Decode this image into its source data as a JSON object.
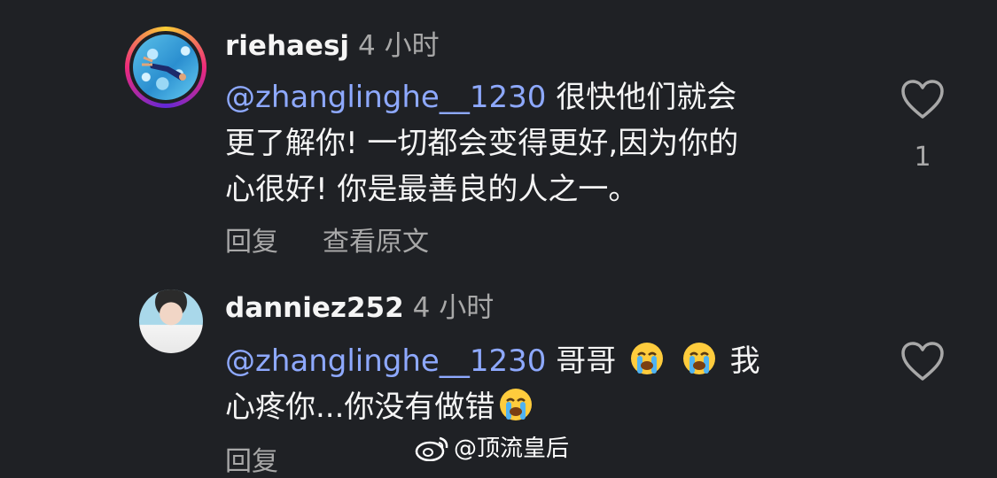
{
  "comments": [
    {
      "username": "riehaesj",
      "time": "4 小时",
      "mention": "@zhanglinghe__1230",
      "text_line1": " 很快他们就会",
      "text_line2": "更了解你! 一切都会变得更好,因为你的",
      "text_line3": "心很好! 你是最善良的人之一。",
      "reply_label": "回复",
      "translate_label": "查看原文",
      "like_count": "1",
      "avatar_icon": "pool-swimmer-avatar",
      "has_story_ring": true
    },
    {
      "username": "danniez252",
      "time": "4 小时",
      "mention": "@zhanglinghe__1230",
      "text_line1_a": " 哥哥 ",
      "text_line1_b": " 我",
      "text_line2": "心疼你...你没有做错",
      "reply_label": "回复",
      "emoji_icon": "loudly-crying-face-emoji",
      "avatar_icon": "portrait-avatar"
    }
  ],
  "watermark": {
    "text": "@顶流皇后",
    "icon": "weibo-icon"
  },
  "colors": {
    "background": "#1f2125",
    "text": "#f5f5f5",
    "secondary": "#a8a8a8",
    "mention": "#8ea9ff"
  }
}
